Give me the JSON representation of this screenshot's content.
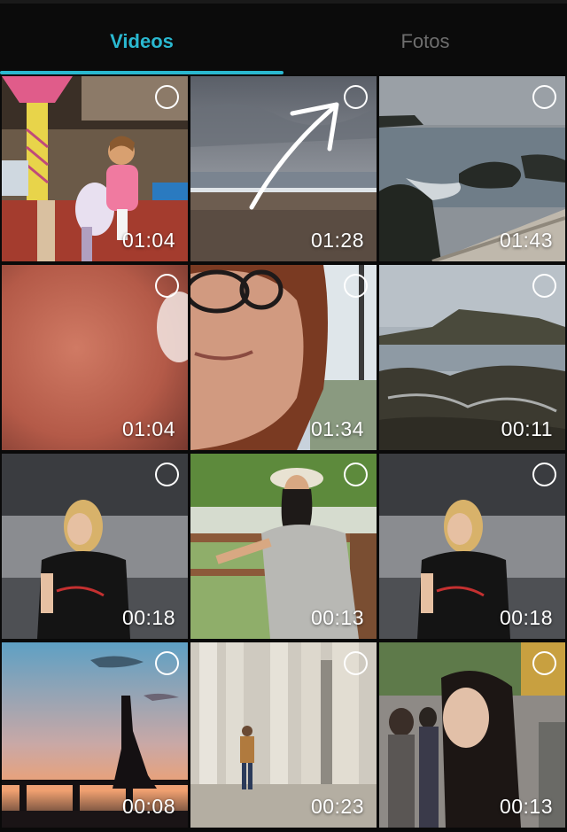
{
  "tabs": [
    {
      "label": "Videos",
      "active": true
    },
    {
      "label": "Fotos",
      "active": false
    }
  ],
  "colors": {
    "accent": "#2ab8d0",
    "inactive_tab": "#6e6e6e",
    "background": "#0a0a0a"
  },
  "videos": [
    {
      "duration": "01:04",
      "scene": "carousel-child"
    },
    {
      "duration": "01:28",
      "scene": "beach-overcast"
    },
    {
      "duration": "01:43",
      "scene": "rocky-coast"
    },
    {
      "duration": "01:04",
      "scene": "blurred-skin"
    },
    {
      "duration": "01:34",
      "scene": "woman-selfie-glasses"
    },
    {
      "duration": "00:11",
      "scene": "rocky-shore"
    },
    {
      "duration": "00:18",
      "scene": "woman-black-tshirt"
    },
    {
      "duration": "00:13",
      "scene": "woman-white-hat-bench"
    },
    {
      "duration": "00:18",
      "scene": "woman-black-tshirt"
    },
    {
      "duration": "00:08",
      "scene": "silhouette-sunset"
    },
    {
      "duration": "00:23",
      "scene": "man-colonnade"
    },
    {
      "duration": "00:13",
      "scene": "crowd-street"
    }
  ],
  "annotation_icon": "arrow-up-right-icon"
}
